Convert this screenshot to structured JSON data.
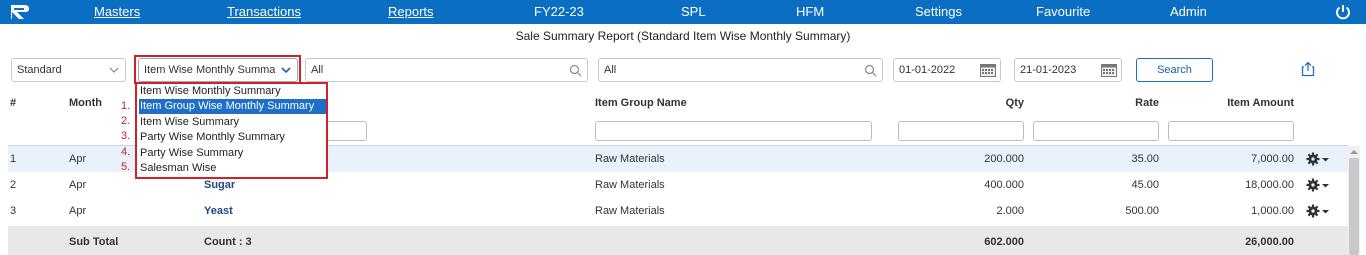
{
  "nav": {
    "items": [
      "Masters",
      "Transactions",
      "Reports",
      "FY22-23",
      "SPL",
      "HFM",
      "Settings",
      "Favourite",
      "Admin"
    ]
  },
  "title": "Sale Summary Report (Standard Item Wise Monthly Summary)",
  "filters": {
    "report_type": "Standard",
    "summary_type": "Item Wise Monthly Summa",
    "filter1": "All",
    "filter2": "All",
    "from_date": "01-01-2022",
    "to_date": "21-01-2023",
    "search_label": "Search"
  },
  "dropdown": {
    "options": [
      "Item Wise Monthly Summary",
      "Item Group Wise Monthly Summary",
      "Item Wise Summary",
      "Party Wise Monthly Summary",
      "Party Wise Summary",
      "Salesman Wise"
    ],
    "highlighted_index": 1,
    "annotation_numbers": [
      "1.",
      "2.",
      "3.",
      "4.",
      "5."
    ]
  },
  "table": {
    "headers": [
      "#",
      "Month",
      "Item Group Name",
      "Qty",
      "Rate",
      "Item Amount"
    ],
    "rows": [
      {
        "num": "1",
        "month": "Apr",
        "item": "",
        "group": "Raw Materials",
        "qty": "200.000",
        "rate": "35.00",
        "amount": "7,000.00"
      },
      {
        "num": "2",
        "month": "Apr",
        "item": "Sugar",
        "group": "Raw Materials",
        "qty": "400.000",
        "rate": "45.00",
        "amount": "18,000.00"
      },
      {
        "num": "3",
        "month": "Apr",
        "item": "Yeast",
        "group": "Raw Materials",
        "qty": "2.000",
        "rate": "500.00",
        "amount": "1,000.00"
      }
    ],
    "subtotal": {
      "label": "Sub Total",
      "count": "Count : 3",
      "qty": "602.000",
      "amount": "26,000.00"
    }
  },
  "colors": {
    "nav": "#0a6fc2",
    "highlight": "#1e6fc8",
    "annotation": "#d0202a"
  }
}
